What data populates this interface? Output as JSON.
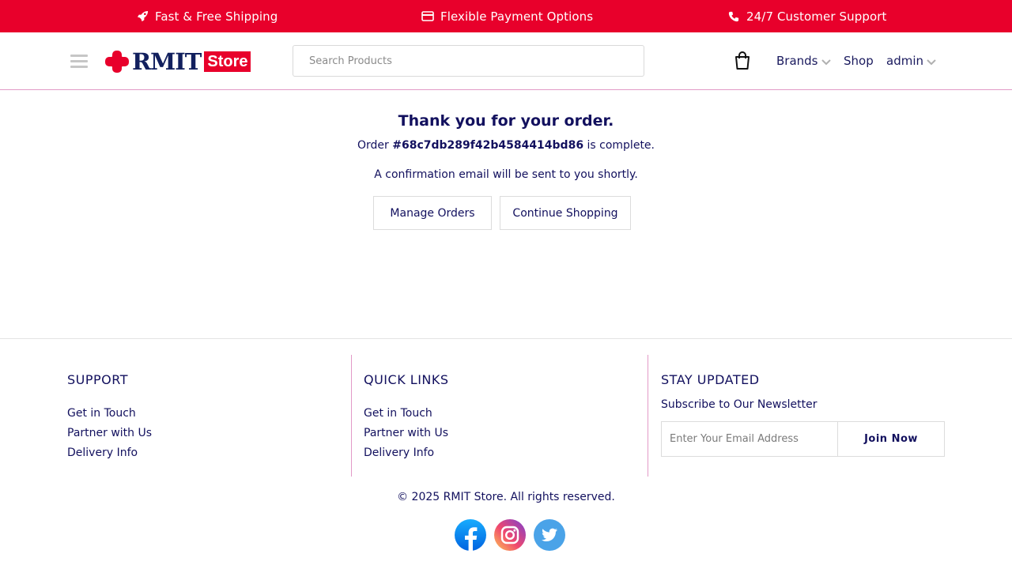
{
  "promo_bar": {
    "items": [
      {
        "icon": "rocket-icon",
        "label": "Fast & Free Shipping"
      },
      {
        "icon": "credit-card-icon",
        "label": "Flexible Payment Options"
      },
      {
        "icon": "phone-icon",
        "label": "24/7 Customer Support"
      }
    ],
    "background": "#e8002b"
  },
  "header": {
    "logo": {
      "text": "RMIT",
      "badge": "Store"
    },
    "search": {
      "placeholder": "Search Products",
      "value": ""
    },
    "nav": {
      "brands": "Brands",
      "shop": "Shop",
      "account": "admin"
    }
  },
  "main": {
    "title": "Thank you for your order.",
    "order_prefix": "Order",
    "order_id": "#68c7db289f42b4584414bd86",
    "order_suffix": "is complete.",
    "confirmation": "A confirmation email will be sent to you shortly.",
    "buttons": {
      "manage_orders": "Manage Orders",
      "continue_shopping": "Continue Shopping"
    }
  },
  "footer": {
    "support": {
      "heading": "SUPPORT",
      "links": [
        "Get in Touch",
        "Partner with Us",
        "Delivery Info"
      ]
    },
    "quick_links": {
      "heading": "QUICK LINKS",
      "links": [
        "Get in Touch",
        "Partner with Us",
        "Delivery Info"
      ]
    },
    "stay_updated": {
      "heading": "STAY UPDATED",
      "subheading": "Subscribe to Our Newsletter",
      "email_placeholder": "Enter Your Email Address",
      "button": "Join Now"
    },
    "copyright": "© 2025 RMIT Store. All rights reserved.",
    "socials": [
      "facebook-icon",
      "instagram-icon",
      "twitter-icon"
    ]
  },
  "colors": {
    "brand_red": "#e8002b",
    "navy": "#12105e",
    "divider_pink": "#e29ac7"
  }
}
